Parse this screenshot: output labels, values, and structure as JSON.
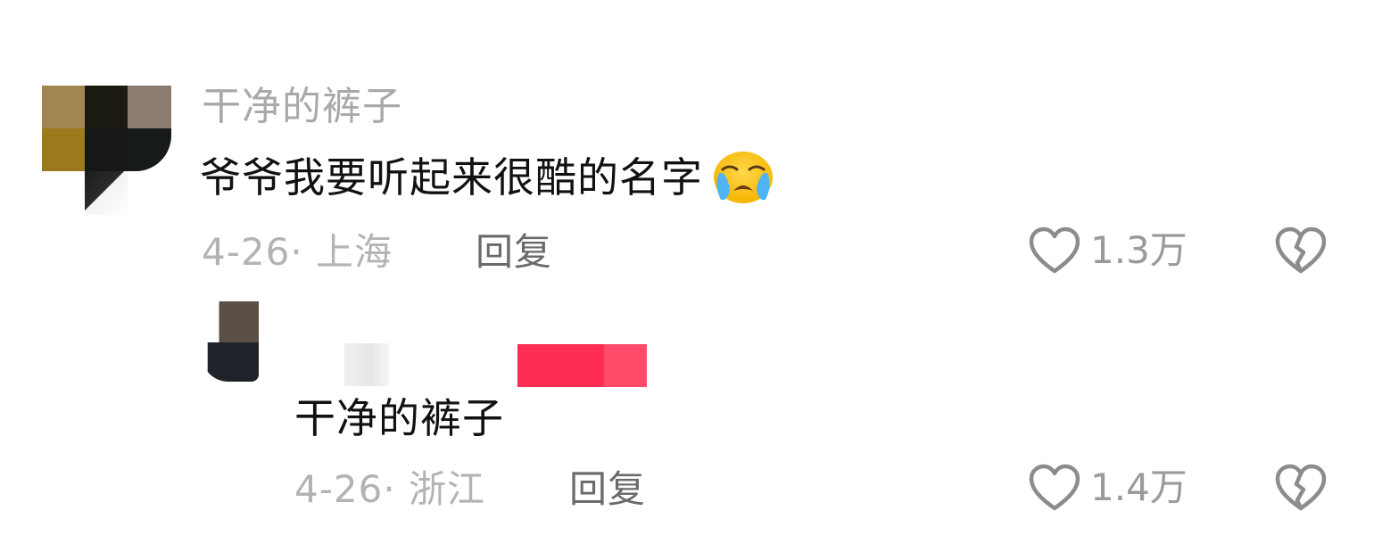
{
  "comment": {
    "username": "干净的裤子",
    "text": "爷爷我要听起来很酷的名字",
    "emoji": "loudly-crying-face",
    "date_location": "4-26· 上海",
    "reply_label": "回复",
    "like_count": "1.3万"
  },
  "reply": {
    "text": "干净的裤子",
    "date_location": "4-26· 浙江",
    "reply_label": "回复",
    "like_count": "1.4万"
  },
  "colors": {
    "username": "#a9a9a9",
    "body_text": "#111111",
    "meta_text": "#b3b3b3",
    "reply_link": "#6a6a6a",
    "icon_stroke": "#8c8c8c",
    "redact_pink": "#ff2d55"
  }
}
